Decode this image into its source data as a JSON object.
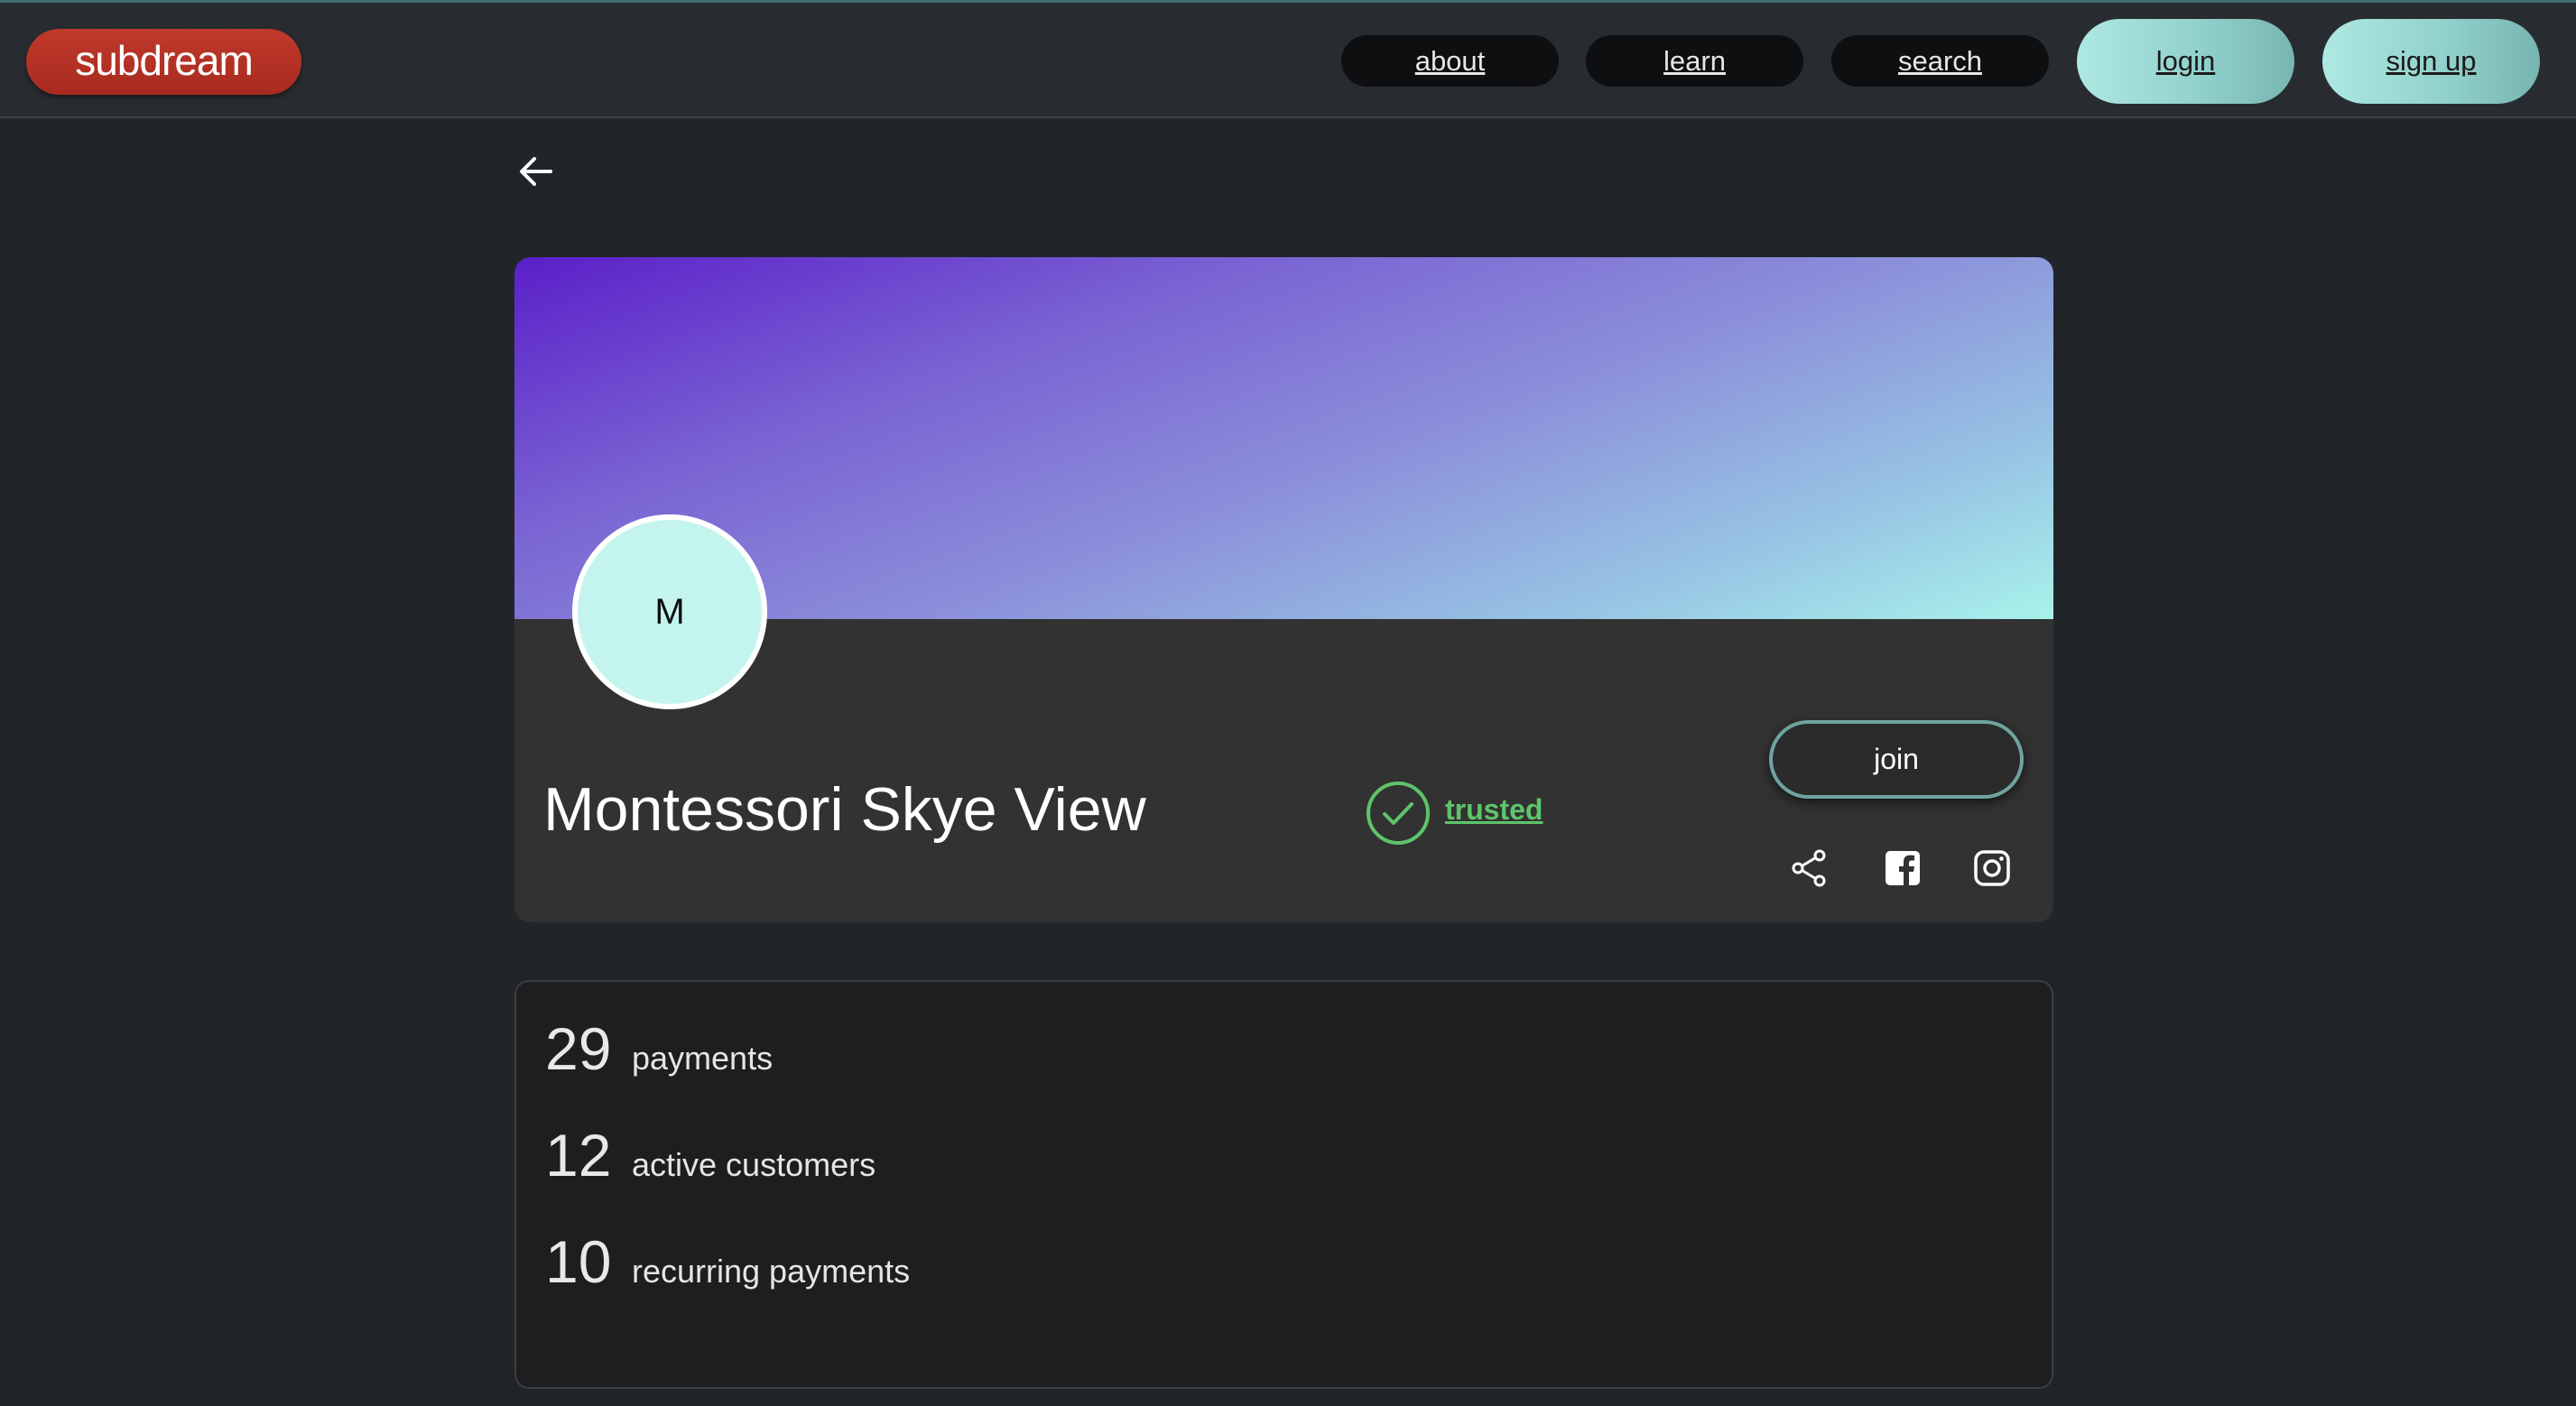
{
  "header": {
    "logo": "subdream",
    "nav": [
      {
        "label": "about"
      },
      {
        "label": "learn"
      },
      {
        "label": "search"
      }
    ],
    "login_label": "login",
    "signup_label": "sign up"
  },
  "profile": {
    "avatar_initial": "M",
    "name": "Montessori Skye View",
    "trusted_label": "trusted",
    "join_label": "join",
    "social_icons": [
      "share-icon",
      "facebook-icon",
      "instagram-icon"
    ]
  },
  "stats": [
    {
      "value": "29",
      "label": "payments"
    },
    {
      "value": "12",
      "label": "active customers"
    },
    {
      "value": "10",
      "label": "recurring payments"
    }
  ],
  "colors": {
    "logo": "#c0392b",
    "accent": "#a8f2ea",
    "trusted": "#5ec46a",
    "banner_start": "#5b1fc9",
    "banner_end": "#a8f2ea"
  }
}
